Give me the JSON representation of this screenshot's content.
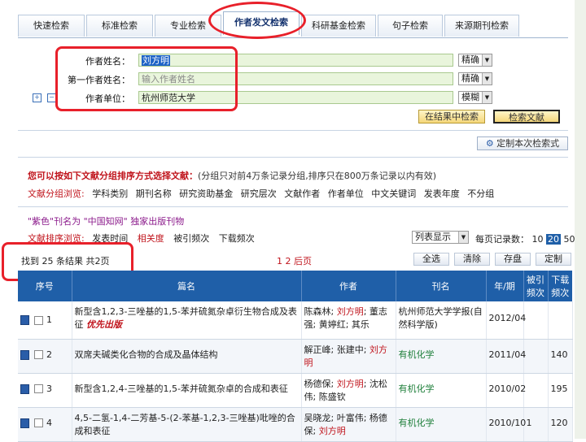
{
  "tabs": [
    "快速检索",
    "标准检索",
    "专业检索",
    "作者发文检索",
    "科研基金检索",
    "句子检索",
    "来源期刊检索"
  ],
  "form": {
    "author_name_label": "作者姓名：",
    "author_name_value": "刘方明",
    "first_author_label": "第一作者姓名：",
    "first_author_placeholder": "输入作者姓名",
    "unit_label": "作者单位：",
    "unit_value": "杭州师范大学",
    "match1": "精确",
    "match2": "精确",
    "match3": "模糊",
    "plus_icon": "+",
    "minus_icon": "−",
    "search_in_results": "在结果中检索",
    "search_docs": "检索文献",
    "custom_search": "定制本次检索式"
  },
  "grouping": {
    "intro": "您可以按如下文献分组排序方式选择文献：",
    "note": "(分组只对前4万条记录分组,排序只在800万条记录以内有效)",
    "browse_label": "文献分组浏览:",
    "options": [
      "学科类别",
      "期刊名称",
      "研究资助基金",
      "研究层次",
      "文献作者",
      "作者单位",
      "中文关键词",
      "发表年度",
      "不分组"
    ],
    "purple_note": "\"紫色\"刊名为 \"中国知网\" 独家出版刊物",
    "sort_label": "文献排序浏览:",
    "sort_options": [
      "发表时间",
      "相关度",
      "被引频次",
      "下载频次"
    ],
    "list_display": "列表显示",
    "per_page_label": "每页记录数：",
    "per_page": [
      "10",
      "20",
      "50"
    ]
  },
  "results": {
    "summary": "找到 25 条结果 共2页",
    "pages": "1 2 后页",
    "buttons": [
      "全选",
      "清除",
      "存盘",
      "定制"
    ]
  },
  "table": {
    "headers": [
      "序号",
      "篇名",
      "作者",
      "刊名",
      "年/期",
      "被引频次",
      "下载频次"
    ],
    "rows": [
      {
        "no": "1",
        "title": "新型含1,2,3-三唑基的1,5-苯并硫氮杂卓衍生物合成及表征",
        "tag": "优先出版",
        "authors_a": "陈森林; ",
        "authors_hl": "刘方明",
        "authors_b": "; 董志强; 黄婷红; 其乐",
        "journal": "杭州师范大学学报(自然科学版)",
        "issue": "2012/04",
        "cited": "",
        "downloads": ""
      },
      {
        "no": "2",
        "title": "双席夫碱类化合物的合成及晶体结构",
        "tag": "",
        "authors_a": "解正峰; 张建中; ",
        "authors_hl": "刘方明",
        "authors_b": "",
        "journal": "有机化学",
        "issue": "2011/04",
        "cited": "",
        "downloads": "140"
      },
      {
        "no": "3",
        "title": "新型含1,2,4-三唑基的1,5-苯并硫氮杂卓的合成和表征",
        "tag": "",
        "authors_a": "杨德保; ",
        "authors_hl": "刘方明",
        "authors_b": "; 沈松伟; 陈盛钦",
        "journal": "有机化学",
        "issue": "2010/02",
        "cited": "",
        "downloads": "195"
      },
      {
        "no": "4",
        "title": "4,5-二氢-1,4-二芳基-5-(2-苯基-1,2,3-三唑基)吡唑的合成和表征",
        "tag": "",
        "authors_a": "吴晓龙; 叶富伟; 杨德保; ",
        "authors_hl": "刘方明",
        "authors_b": "",
        "journal": "有机化学",
        "issue": "2010/10",
        "cited": "1",
        "downloads": "120"
      }
    ]
  },
  "colors": {
    "accent": "#1f5fa8",
    "highlight_ring": "#e8202a",
    "author_highlight": "#c0141c",
    "journal_green": "#1e7f3a"
  }
}
